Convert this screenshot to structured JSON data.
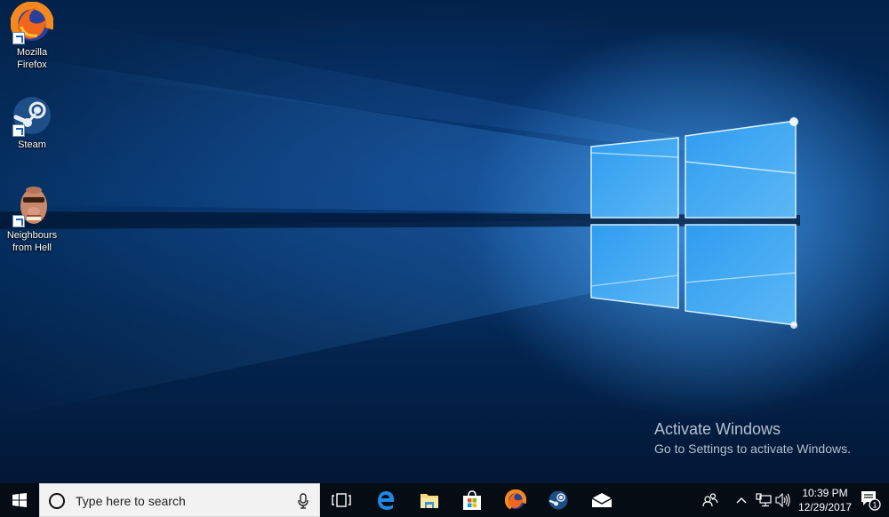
{
  "desktop": {
    "icons": [
      {
        "label_line1": "Mozilla",
        "label_line2": "Firefox",
        "icon": "firefox-icon"
      },
      {
        "label_line1": "Steam",
        "label_line2": "",
        "icon": "steam-icon"
      },
      {
        "label_line1": "Neighbours",
        "label_line2": "from Hell",
        "icon": "neighbours-from-hell-icon"
      }
    ]
  },
  "watermark": {
    "title": "Activate Windows",
    "subtitle": "Go to Settings to activate Windows."
  },
  "taskbar": {
    "search_placeholder": "Type here to search",
    "pinned": [
      {
        "name": "task-view",
        "icon": "task-view-icon"
      },
      {
        "name": "edge",
        "icon": "edge-icon"
      },
      {
        "name": "file-explorer",
        "icon": "folder-icon"
      },
      {
        "name": "store",
        "icon": "store-icon"
      },
      {
        "name": "firefox",
        "icon": "firefox-icon"
      },
      {
        "name": "steam",
        "icon": "steam-icon"
      },
      {
        "name": "mail",
        "icon": "mail-icon"
      }
    ],
    "tray": {
      "time": "10:39 PM",
      "date": "12/29/2017",
      "notification_count": "1"
    }
  },
  "colors": {
    "taskbar_bg": "#060c14",
    "search_bg": "#f2f2f2",
    "accent": "#1e88e5"
  }
}
